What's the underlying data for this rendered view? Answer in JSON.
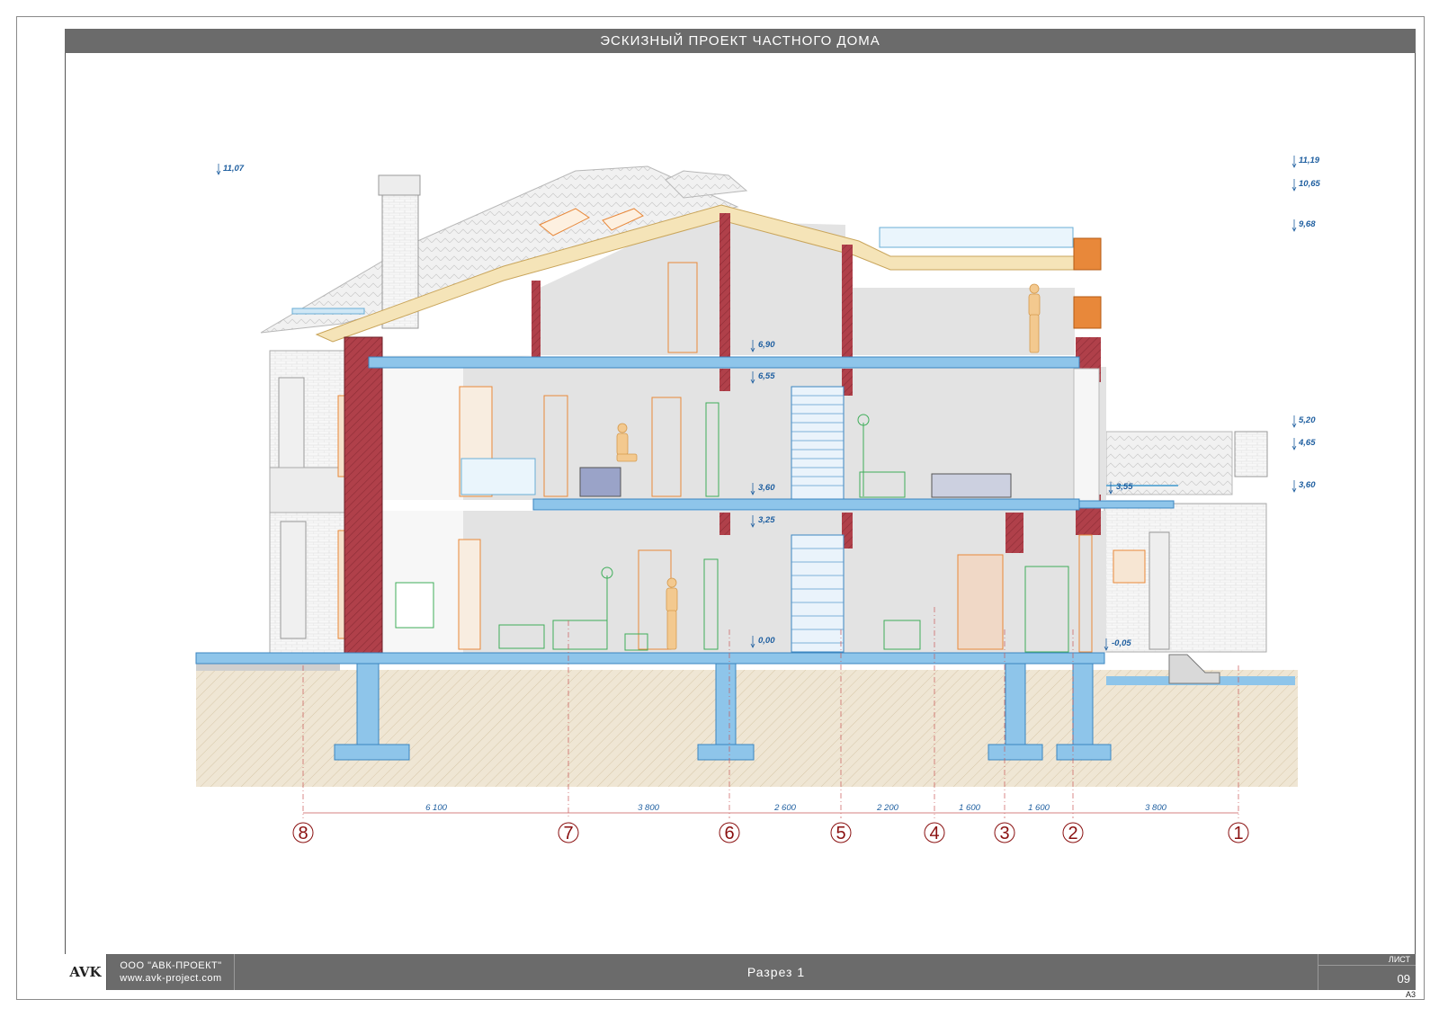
{
  "header": {
    "title": "ЭСКИЗНЫЙ ПРОЕКТ ЧАСТНОГО ДОМА"
  },
  "footer": {
    "logo": "AVK",
    "company": "ООО \"АВК-ПРОЕКТ\"",
    "website": "www.avk-project.com",
    "sheet_name": "Разрез 1",
    "sheet_label": "ЛИСТ",
    "sheet_number": "09",
    "format": "А3"
  },
  "levels_left": [
    "11,07"
  ],
  "levels_right": [
    "11,19",
    "10,65",
    "9,68",
    "5,20",
    "4,65",
    "3,60"
  ],
  "levels_inner": [
    "6,90",
    "6,55",
    "3,60",
    "3,25",
    "0,00",
    "3,55",
    "-0,05"
  ],
  "dimensions": [
    "6 100",
    "3 800",
    "2 600",
    "2 200",
    "1 600",
    "1 600",
    "3 800"
  ],
  "axes": [
    "8",
    "7",
    "6",
    "5",
    "4",
    "3",
    "2",
    "1"
  ],
  "colors": {
    "slab": "#8ec5ea",
    "wall": "#b0404a",
    "ground": "#ece2cf",
    "room": "#dedede",
    "fixture_orange": "#e8883a",
    "fixture_green": "#3fae5a",
    "level_text": "#1f5fa0",
    "axis_text": "#8a1010"
  }
}
